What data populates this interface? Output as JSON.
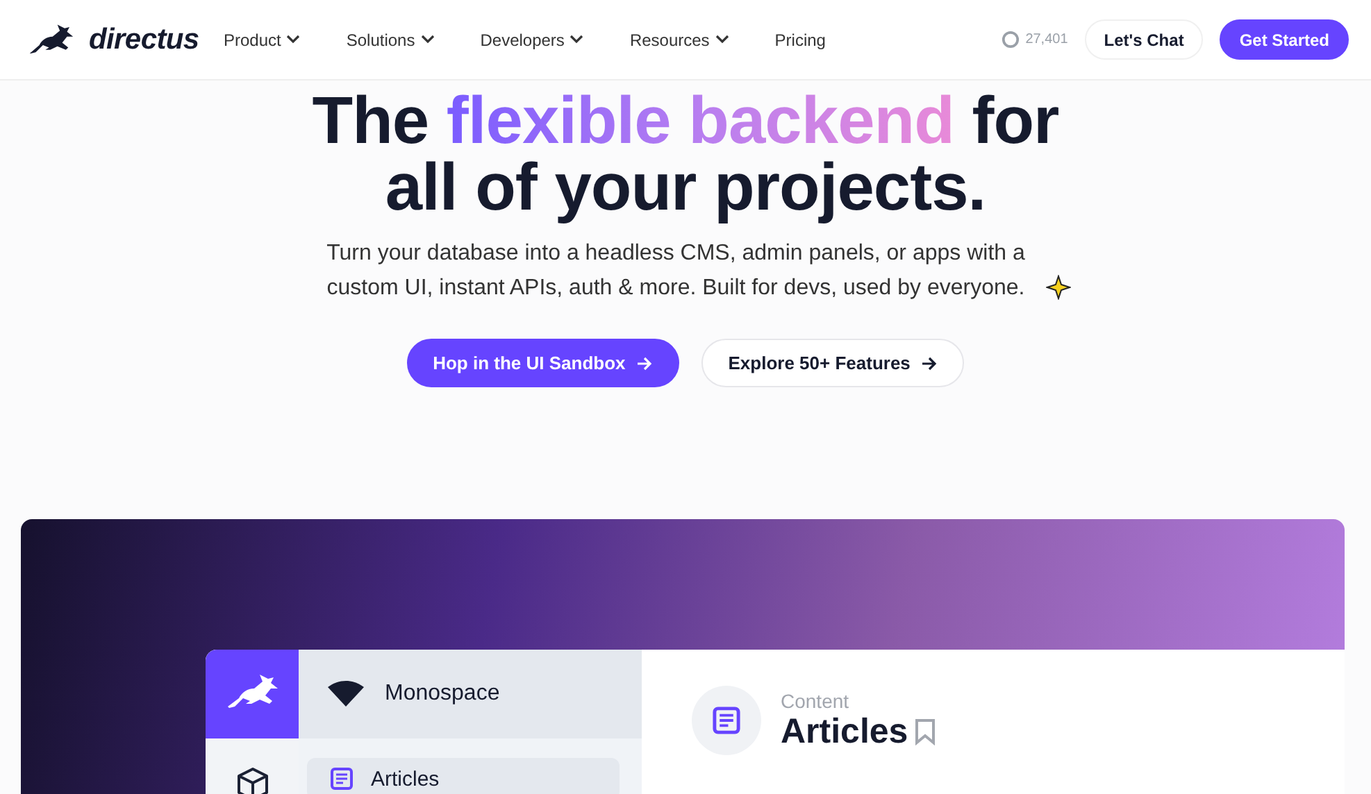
{
  "brand": "directus",
  "nav": [
    {
      "label": "Product",
      "dropdown": true
    },
    {
      "label": "Solutions",
      "dropdown": true
    },
    {
      "label": "Developers",
      "dropdown": true
    },
    {
      "label": "Resources",
      "dropdown": true
    },
    {
      "label": "Pricing",
      "dropdown": false
    }
  ],
  "github_stars": "27,401",
  "header_buttons": [
    {
      "label": "Let's Chat",
      "kind": "secondary"
    },
    {
      "label": "Get Started",
      "kind": "primary"
    }
  ],
  "hero": {
    "title_start": "The ",
    "title_highlight": "flexible backend",
    "title_end": " for all of your projects.",
    "subtitle": "Turn your database into a headless CMS, admin panels, or apps with a custom UI, instant APIs, auth & more. Built for devs, used by everyone.",
    "buttons": [
      {
        "label": "Hop in the UI Sandbox",
        "kind": "primary"
      },
      {
        "label": "Explore 50+ Features",
        "kind": "secondary"
      }
    ]
  },
  "app_preview": {
    "project": "Monospace",
    "nav_items": [
      {
        "label": "Articles",
        "selected": true
      }
    ],
    "breadcrumb": "Content",
    "page_title": "Articles"
  }
}
